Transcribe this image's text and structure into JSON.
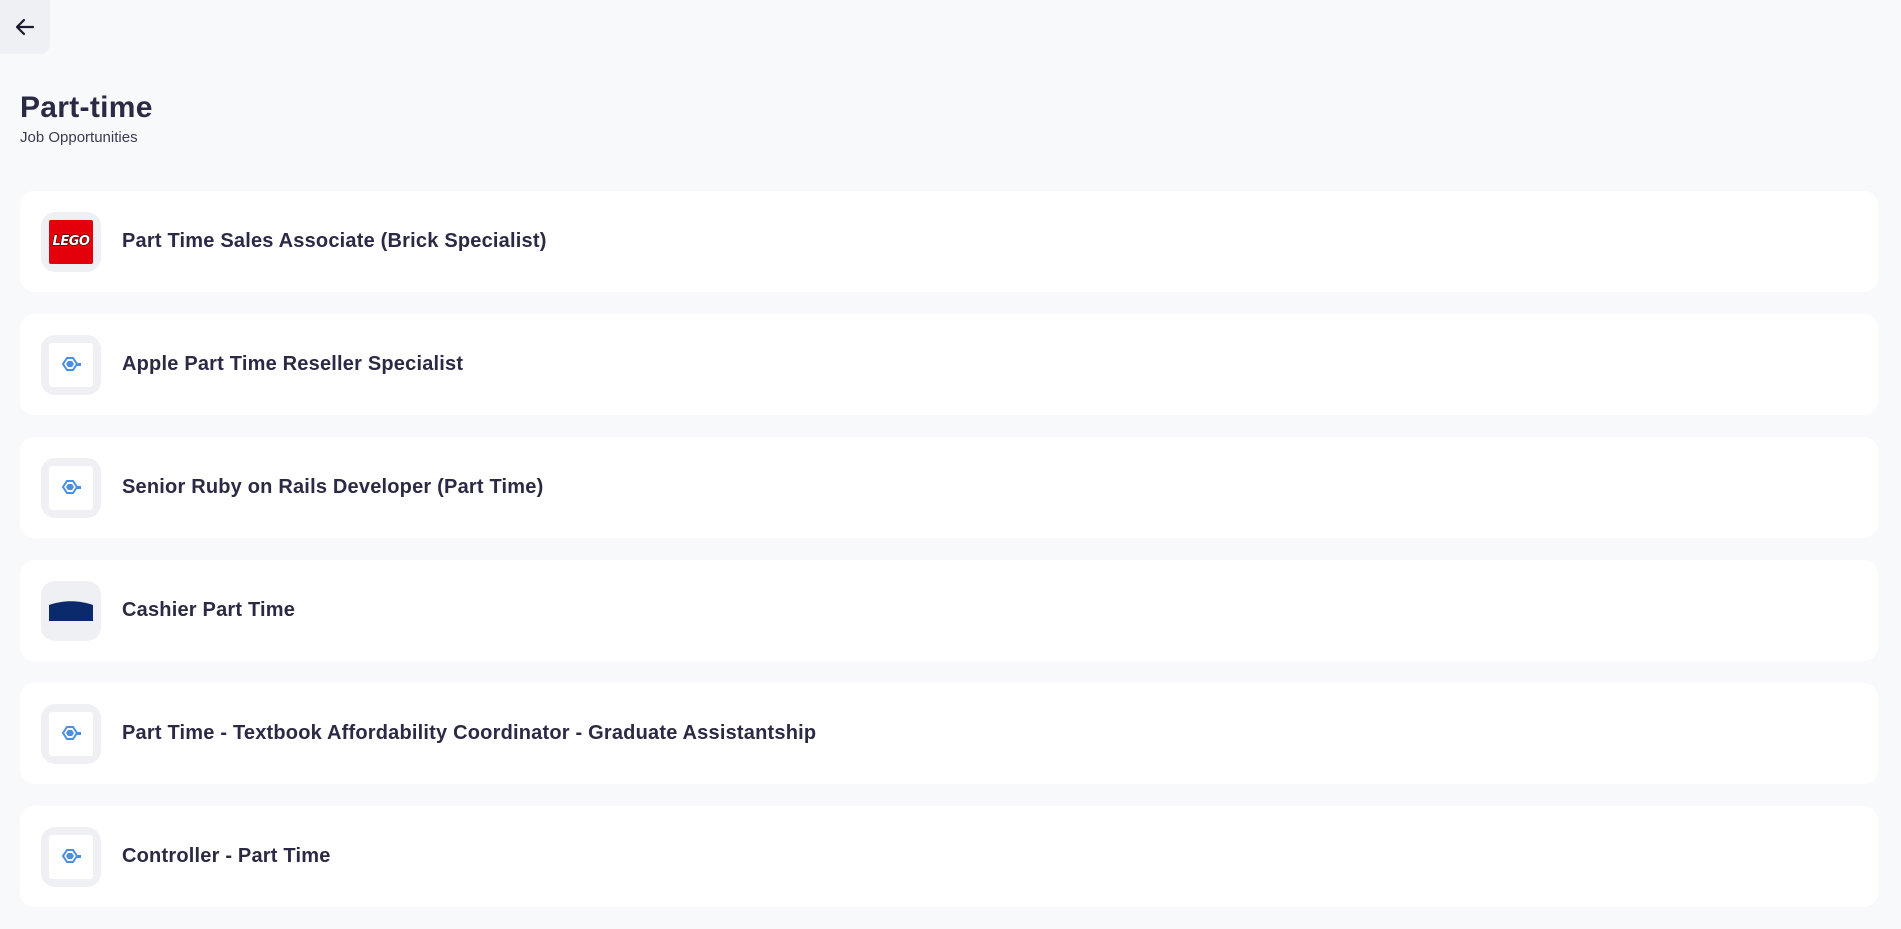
{
  "nav": {
    "back_icon": "arrow-left-icon"
  },
  "header": {
    "title": "Part-time",
    "subtitle": "Job Opportunities"
  },
  "jobs": [
    {
      "title": "Part Time Sales Associate (Brick Specialist)",
      "logo": "lego-logo",
      "logo_text": "LEGO"
    },
    {
      "title": "Apple Part Time Reseller Specialist",
      "logo": "default-company-icon"
    },
    {
      "title": "Senior Ruby on Rails Developer (Part Time)",
      "logo": "default-company-icon"
    },
    {
      "title": "Cashier Part Time",
      "logo": "navy-company-logo"
    },
    {
      "title": "Part Time - Textbook Affordability Coordinator - Graduate Assistantship",
      "logo": "default-company-icon"
    },
    {
      "title": "Controller - Part Time",
      "logo": "default-company-icon"
    }
  ],
  "colors": {
    "background": "#f8f9fb",
    "card": "#ffffff",
    "text": "#2a2a45",
    "lego_red": "#e3000b",
    "icon_blue": "#4a8fe0",
    "navy": "#0a2a6b"
  }
}
